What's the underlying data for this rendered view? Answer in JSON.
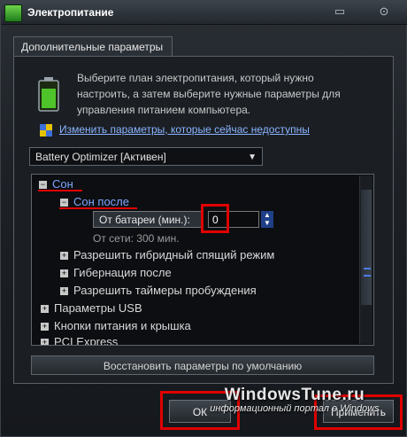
{
  "window": {
    "title": "Электропитание"
  },
  "titlebar": {
    "restore_icon": "restore-icon",
    "help_icon": "help-icon"
  },
  "tab": {
    "label": "Дополнительные параметры"
  },
  "intro": {
    "description": "Выберите план электропитания, который нужно настроить, а затем выберите нужные параметры для управления питанием компьютера.",
    "change_link": "Изменить параметры, которые сейчас недоступны"
  },
  "plan_select": {
    "value": "Battery Optimizer [Активен]"
  },
  "tree": {
    "sleep": {
      "toggle": "−",
      "label": "Сон"
    },
    "sleep_after": {
      "toggle": "−",
      "label": "Сон после"
    },
    "on_battery": {
      "label": "От батареи (мин.):",
      "value": "0"
    },
    "on_ac": {
      "label": "От сети: 300 мин."
    },
    "hybrid": {
      "toggle": "+",
      "label": "Разрешить гибридный спящий режим"
    },
    "hibernate": {
      "toggle": "+",
      "label": "Гибернация после"
    },
    "wake_timers": {
      "toggle": "+",
      "label": "Разрешить таймеры пробуждения"
    },
    "usb": {
      "toggle": "+",
      "label": "Параметры USB"
    },
    "power_buttons": {
      "toggle": "+",
      "label": "Кнопки питания и крышка"
    },
    "pci": {
      "toggle": "+",
      "label": "PCI Express"
    }
  },
  "buttons": {
    "restore_defaults": "Восстановить параметры по умолчанию",
    "ok": "ОК",
    "apply": "Применить"
  },
  "watermark": {
    "main": "WindowsTune.ru",
    "sub": "информационный портал о Windows"
  },
  "colors": {
    "highlight": "#e00000",
    "link": "#8ab4ff",
    "selection": "#7fa7ff"
  }
}
